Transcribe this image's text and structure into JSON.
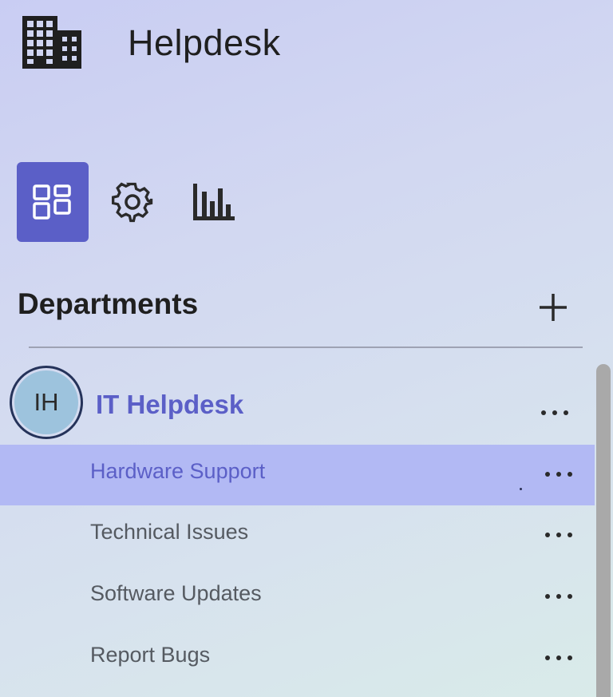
{
  "app": {
    "title": "Helpdesk",
    "logo_icon": "building-icon"
  },
  "nav": {
    "items": [
      {
        "icon": "apps-icon",
        "active": true
      },
      {
        "icon": "gear-icon",
        "active": false
      },
      {
        "icon": "bar-chart-icon",
        "active": false
      }
    ]
  },
  "sidebar": {
    "section_title": "Departments",
    "add_icon": "plus-icon",
    "group": {
      "avatar_initials": "IH",
      "name": "IT Helpdesk",
      "items": [
        {
          "label": "Hardware Support",
          "selected": true
        },
        {
          "label": "Technical Issues",
          "selected": false
        },
        {
          "label": "Software Updates",
          "selected": false
        },
        {
          "label": "Report Bugs",
          "selected": false
        }
      ]
    }
  },
  "colors": {
    "accent": "#5b5fc7",
    "selected_bg": "#b2b9f4",
    "avatar_bg": "#9dc3dd",
    "avatar_ring": "#25335a"
  }
}
